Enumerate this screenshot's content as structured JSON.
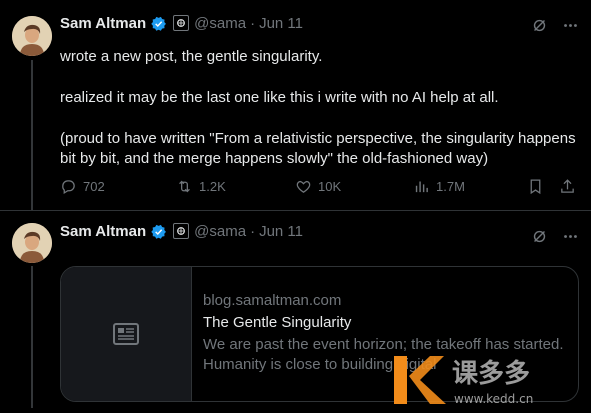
{
  "tweets": [
    {
      "author_name": "Sam Altman",
      "handle": "@sama",
      "separator": "·",
      "date": "Jun 11",
      "text_lines": [
        "wrote a new post, the gentle singularity.",
        "realized it may be the last one like this i write with no AI help at all.",
        "(proud to have written \"From a relativistic perspective, the singularity happens bit by bit, and the merge happens slowly\" the old-fashioned way)"
      ],
      "replies": "702",
      "reposts": "1.2K",
      "likes": "10K",
      "views": "1.7M"
    },
    {
      "author_name": "Sam Altman",
      "handle": "@sama",
      "separator": "·",
      "date": "Jun 11",
      "card": {
        "domain": "blog.samaltman.com",
        "title": "The Gentle Singularity",
        "description": "We are past the event horizon; the takeoff has started. Humanity is close to building digital"
      }
    }
  ],
  "watermark": {
    "text": "课多多",
    "url": "www.kedd.cn"
  },
  "colors": {
    "background": "#000000",
    "text": "#e7e9ea",
    "secondary": "#71767b",
    "verified": "#1d9bf0",
    "border": "#2f3336"
  },
  "icons": [
    "verified-badge-icon",
    "affiliate-badge-icon",
    "grok-icon",
    "more-icon",
    "reply-icon",
    "repost-icon",
    "like-icon",
    "views-icon",
    "bookmark-icon",
    "share-icon",
    "article-icon"
  ]
}
